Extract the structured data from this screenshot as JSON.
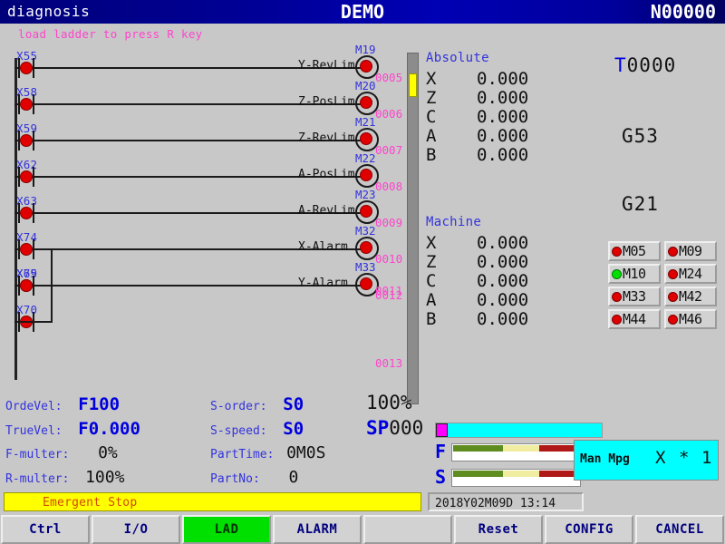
{
  "titlebar": {
    "left": "diagnosis",
    "center": "DEMO",
    "right": "N00000"
  },
  "ladder": {
    "hint": "load ladder to press R key",
    "rungs": [
      {
        "contacts": [
          "X55"
        ],
        "coil": "M19",
        "coil_text": "Y-RevLim",
        "number": "0005"
      },
      {
        "contacts": [
          "X58"
        ],
        "coil": "M20",
        "coil_text": "Z-PosLim",
        "number": "0006"
      },
      {
        "contacts": [
          "X59"
        ],
        "coil": "M21",
        "coil_text": "Z-RevLim",
        "number": "0007"
      },
      {
        "contacts": [
          "X62"
        ],
        "coil": "M22",
        "coil_text": "A-PosLim",
        "number": "0008"
      },
      {
        "contacts": [
          "X63"
        ],
        "coil": "M23",
        "coil_text": "A-RevLim",
        "number": "0009"
      },
      {
        "contacts": [
          "X74",
          "X69"
        ],
        "coil": "M32",
        "coil_text": "X-Alarm",
        "number": "0010"
      },
      {
        "contacts": [
          "X75",
          "X70"
        ],
        "coil": "M33",
        "coil_text": "Y-Alarm",
        "number": "0012"
      }
    ],
    "extra_numbers": [
      "0011",
      "0013"
    ]
  },
  "coordinates": {
    "absolute": {
      "title": "Absolute",
      "axes": [
        {
          "name": "X",
          "value": "0.000"
        },
        {
          "name": "Z",
          "value": "0.000"
        },
        {
          "name": "C",
          "value": "0.000"
        },
        {
          "name": "A",
          "value": "0.000"
        },
        {
          "name": "B",
          "value": "0.000"
        }
      ]
    },
    "machine": {
      "title": "Machine",
      "axes": [
        {
          "name": "X",
          "value": "0.000"
        },
        {
          "name": "Z",
          "value": "0.000"
        },
        {
          "name": "C",
          "value": "0.000"
        },
        {
          "name": "A",
          "value": "0.000"
        },
        {
          "name": "B",
          "value": "0.000"
        }
      ]
    }
  },
  "codes": {
    "tool_prefix": "T",
    "tool_number": "0000",
    "gcode_1": "G53",
    "gcode_2": "G21"
  },
  "mcodes": [
    {
      "label": "M05",
      "state": "off"
    },
    {
      "label": "M09",
      "state": "off"
    },
    {
      "label": "M10",
      "state": "on"
    },
    {
      "label": "M24",
      "state": "off"
    },
    {
      "label": "M33",
      "state": "off"
    },
    {
      "label": "M42",
      "state": "off"
    },
    {
      "label": "M44",
      "state": "off"
    },
    {
      "label": "M46",
      "state": "off"
    }
  ],
  "params": {
    "ordevel_label": "OrdeVel:",
    "ordevel_value": "F100",
    "truevel_label": "TrueVel:",
    "truevel_value": "F0.000",
    "fmulter_label": "F-multer:",
    "fmulter_value": "0%",
    "rmulter_label": "R-multer:",
    "rmulter_value": "100%",
    "sorder_label": "S-order:",
    "sorder_value": "S0",
    "sspeed_label": "S-speed:",
    "sspeed_value": "S0",
    "parttime_label": "PartTime:",
    "parttime_value": "0M0S",
    "partno_label": "PartNo:",
    "partno_value": "0",
    "spindle_percent": "100%",
    "spindle_sp": "SP",
    "spindle_sp_value": "000"
  },
  "gauges": {
    "feed_letter": "F",
    "speed_letter": "S"
  },
  "handwheel": {
    "label": "Man Mpg",
    "axis": "X",
    "multiply": "*",
    "value": "1"
  },
  "alarm": {
    "text": "Emergent Stop"
  },
  "datetime": {
    "text": "2018Y02M09D 13:14"
  },
  "tabs": [
    {
      "label": "Ctrl",
      "active": false
    },
    {
      "label": "I/O",
      "active": false
    },
    {
      "label": "LAD",
      "active": true
    },
    {
      "label": "ALARM",
      "active": false
    },
    {
      "label": "",
      "active": false
    },
    {
      "label": "Reset",
      "active": false
    },
    {
      "label": "CONFIG",
      "active": false
    },
    {
      "label": "CANCEL",
      "active": false
    }
  ],
  "colors": {
    "title_blue": "#000096",
    "hint_pink": "#ff44cc",
    "contact_red": "#e00000",
    "led_on_green": "#00e000",
    "label_blue": "#3333dd",
    "alarm_yellow": "#ffff00",
    "alarm_text": "#d24b00",
    "cyan": "#00ffff",
    "background": "#c8c8c8"
  }
}
